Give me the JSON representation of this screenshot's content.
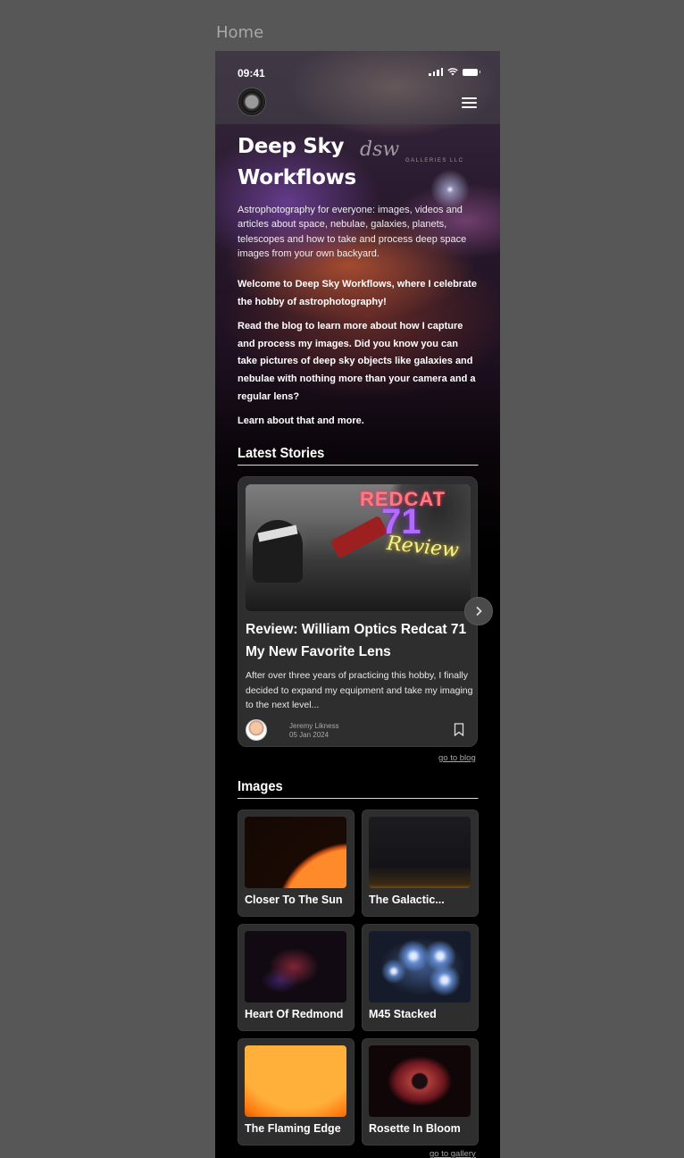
{
  "frame_label": "Home",
  "status_bar": {
    "time": "09:41"
  },
  "hero": {
    "title_line1": "Deep Sky",
    "title_line2": "Workflows",
    "brand_script": "dsw",
    "brand_sub": "GALLERIES LLC",
    "tagline": "Astrophotography for everyone: images, videos and articles about space, nebulae, galaxies, planets, telescopes and how to take and process deep space images from your own backyard.",
    "intro_1": "Welcome to Deep Sky Workflows, where I celebrate the hobby of astrophotography!",
    "intro_2": "Read the blog to learn more about how I capture and process my images. Did you know you can take pictures of deep sky objects like galaxies and nebulae with nothing more than your camera and a regular lens?",
    "intro_3": "Learn about that and more."
  },
  "latest_stories": {
    "title": "Latest Stories",
    "card": {
      "image_text_1": "REDCAT",
      "image_text_2": "71",
      "image_text_3": "Review",
      "headline": "Review: William Optics Redcat 71 My New Favorite Lens",
      "excerpt": "After over three years of practicing this hobby, I finally decided to expand my equipment and take my imaging to the next level...",
      "author": "Jeremy Likness",
      "date": "05 Jan 2024"
    },
    "link": "go to blog"
  },
  "images": {
    "title": "Images",
    "items": [
      {
        "label": "Closer To The Sun"
      },
      {
        "label": "The Galactic..."
      },
      {
        "label": "Heart Of Redmond"
      },
      {
        "label": "M45 Stacked"
      },
      {
        "label": "The Flaming Edge"
      },
      {
        "label": "Rosette In Bloom"
      }
    ],
    "link": "go to gallery"
  }
}
